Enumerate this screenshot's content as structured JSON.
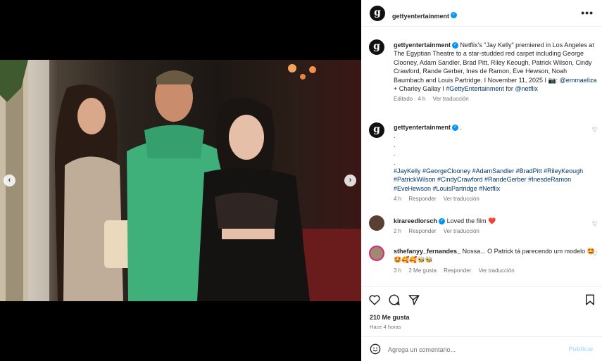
{
  "post": {
    "author": "gettyentertainment",
    "avatar_letter": "g",
    "more_icon": "more-dots-icon"
  },
  "caption": {
    "author": "gettyentertainment",
    "text_before": "Netflix's \"Jay Kelly\" premiered in Los Angeles at The Egyptian Theatre to a star-studded red carpet including George Clooney, Adam Sandler, Brad Pitt, Riley Keough, Patrick Wilson, Cindy Crawford, Rande Gerber, Ines de Ramon, Eve Hewson, Noah Baumbach and Louis Partridge. I November 11, 2025 I 📷: ",
    "mention_1": "@emmaeliza",
    "text_middle": " + Charley Gallay I ",
    "hashtag": "#GettyEntertainment",
    "text_for": " for ",
    "mention_2": "@netflix",
    "edited": "Editado · 4 h",
    "see_translation": "Ver traducción"
  },
  "comments": [
    {
      "author": "gettyentertainment",
      "text": ".",
      "dots": [
        ".",
        ".",
        ".",
        "."
      ],
      "hashtags": "#JayKelly #GeorgeClooney #AdamSandler #BradPitt #RileyKeough #PatrickWilson #CindyCrawford #RandeGerber #InesdeRamon #EveHewson #LouisPartridge #Netflix",
      "time": "4 h",
      "reply": "Responder",
      "translate": "Ver traducción"
    },
    {
      "author": "kirareedlorsch",
      "text": "Loved the film ❤️",
      "time": "2 h",
      "reply": "Responder",
      "translate": "Ver traducción"
    },
    {
      "author": "sthefanyy_fernandes_",
      "text": "Nossa... O Patrick tá parecendo um modelo 🤩🤩🥰🥰🐝🐝",
      "time": "3 h",
      "likes": "2 Me gusta",
      "reply": "Responder",
      "translate": "Ver traducción"
    }
  ],
  "actions": {
    "likes": "210 Me gusta",
    "time": "Hace 4 horas"
  },
  "add_comment": {
    "placeholder": "Agrega un comentario...",
    "publish": "Publicar"
  },
  "carousel": {
    "total_slides": 9,
    "active_slide": 4
  },
  "colors": {
    "accent": "#0095f6",
    "link": "#00376b",
    "publish_disabled": "#b2dffc",
    "heart_red": "#ed4956"
  }
}
